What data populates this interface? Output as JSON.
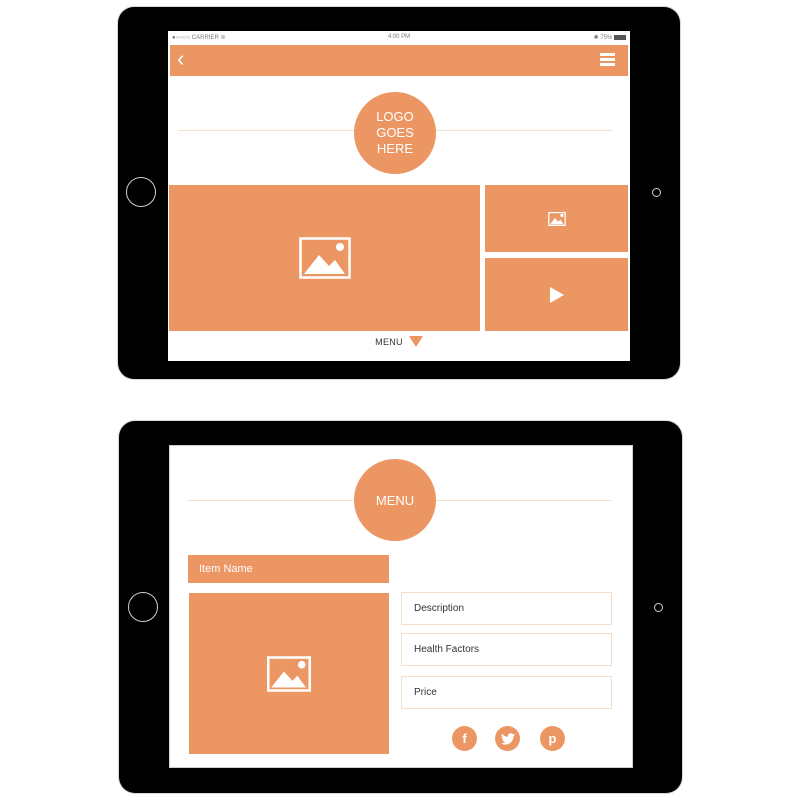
{
  "colors": {
    "accent": "#ec9663",
    "divider": "#f1dfc9",
    "device": "#000000"
  },
  "screen1": {
    "status_bar": {
      "carrier": "●○○○○ CARRIER",
      "wifi_icon": "wifi-icon",
      "time": "4:00 PM",
      "battery": "75%",
      "bluetooth_icon": "bluetooth-icon"
    },
    "nav": {
      "back_icon": "chevron-left-icon",
      "back_glyph": "‹",
      "menu_icon": "hamburger-icon"
    },
    "logo": {
      "text": "LOGO\nGOES\nHERE"
    },
    "tiles": [
      {
        "kind": "image",
        "icon": "image-icon"
      },
      {
        "kind": "image",
        "icon": "image-icon"
      },
      {
        "kind": "video",
        "icon": "play-icon"
      }
    ],
    "menu_toggle": {
      "label": "MENU",
      "icon": "triangle-down-icon"
    }
  },
  "screen2": {
    "title": "MENU",
    "item_name": "Item Name",
    "fields": [
      {
        "label": "Description"
      },
      {
        "label": "Health Factors"
      },
      {
        "label": "Price"
      }
    ],
    "social": [
      {
        "name": "facebook",
        "glyph": "f"
      },
      {
        "name": "twitter",
        "glyph": "t"
      },
      {
        "name": "pinterest",
        "glyph": "p"
      }
    ]
  }
}
